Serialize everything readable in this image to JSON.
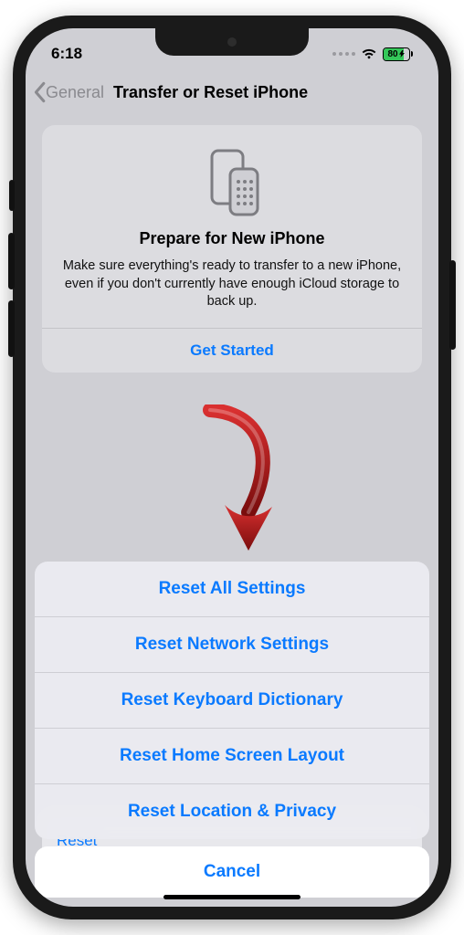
{
  "status": {
    "time": "6:18",
    "battery_text": "80"
  },
  "nav": {
    "back_label": "General",
    "title": "Transfer or Reset iPhone"
  },
  "card": {
    "heading": "Prepare for New iPhone",
    "body": "Make sure everything's ready to transfer to a new iPhone, even if you don't currently have enough iCloud storage to back up.",
    "cta": "Get Started"
  },
  "under_row_label": "Reset",
  "sheet": {
    "options": [
      "Reset All Settings",
      "Reset Network Settings",
      "Reset Keyboard Dictionary",
      "Reset Home Screen Layout",
      "Reset Location & Privacy"
    ],
    "cancel": "Cancel"
  }
}
